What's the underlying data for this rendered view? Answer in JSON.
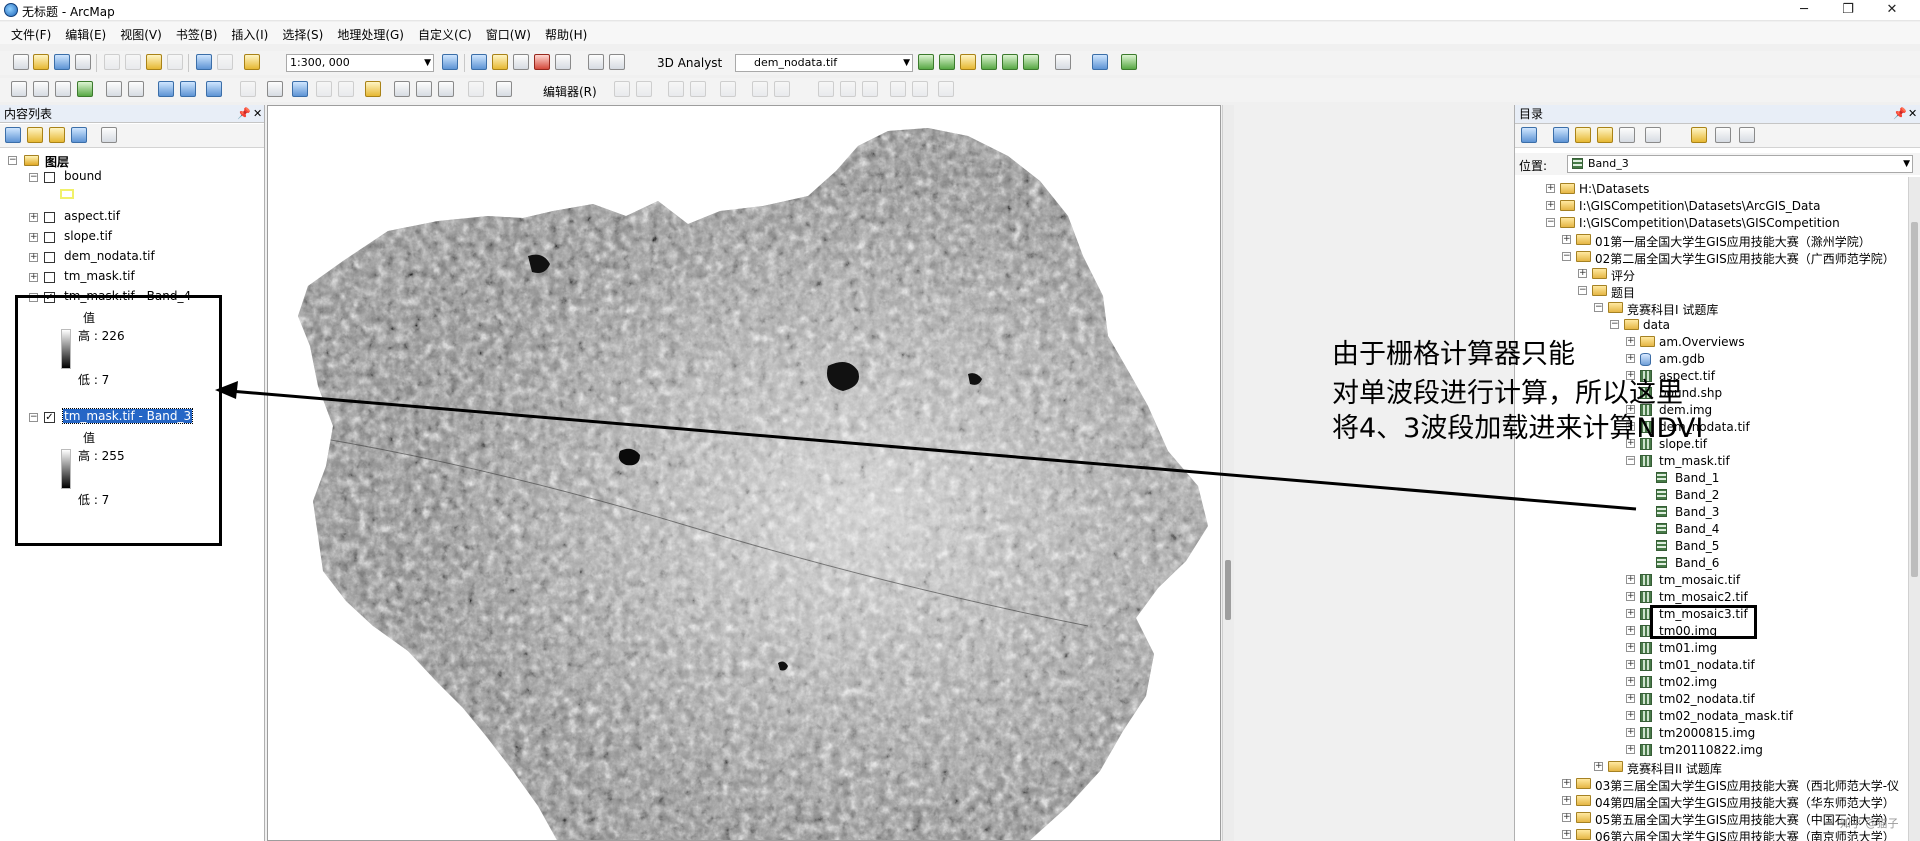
{
  "window": {
    "title": "无标题 - ArcMap",
    "minimize": "─",
    "maximize": "❐",
    "close": "✕"
  },
  "menu": [
    "文件(F)",
    "编辑(E)",
    "视图(V)",
    "书签(B)",
    "插入(I)",
    "选择(S)",
    "地理处理(G)",
    "自定义(C)",
    "窗口(W)",
    "帮助(H)"
  ],
  "toolbar": {
    "scale": "1:300, 000",
    "analyst": "3D Analyst",
    "layer_combo": "dem_nodata.tif",
    "editor": "编辑器(R)"
  },
  "toc": {
    "title": "内容列表",
    "root": "图层",
    "layers": [
      {
        "name": "bound",
        "checked": false,
        "expanded": true
      },
      {
        "name": "aspect.tif",
        "checked": false,
        "expanded": false
      },
      {
        "name": "slope.tif",
        "checked": false,
        "expanded": false
      },
      {
        "name": "dem_nodata.tif",
        "checked": false,
        "expanded": false
      },
      {
        "name": "tm_mask.tif",
        "checked": false,
        "expanded": false
      },
      {
        "name": "tm_mask.tif - Band_4",
        "checked": true,
        "expanded": true,
        "value_label": "值",
        "high": "高 : 226",
        "low": "低 : 7"
      },
      {
        "name": "tm_mask.tif - Band_3",
        "checked": true,
        "expanded": true,
        "selected": true,
        "value_label": "值",
        "high": "高 : 255",
        "low": "低 : 7"
      }
    ]
  },
  "catalog": {
    "title": "目录",
    "location_label": "位置:",
    "location_value": "Band_3",
    "tree": [
      {
        "label": "H:\\Datasets",
        "level": 0,
        "exp": "+",
        "icon": "folder"
      },
      {
        "label": "I:\\GISCompetition\\Datasets\\ArcGIS_Data",
        "level": 0,
        "exp": "+",
        "icon": "folder"
      },
      {
        "label": "I:\\GISCompetition\\Datasets\\GISCompetition",
        "level": 0,
        "exp": "−",
        "icon": "folder"
      },
      {
        "label": "01第一届全国大学生GIS应用技能大赛（滁州学院）",
        "level": 1,
        "exp": "+",
        "icon": "folder"
      },
      {
        "label": "02第二届全国大学生GIS应用技能大赛（广西师范学院）",
        "level": 1,
        "exp": "−",
        "icon": "folder"
      },
      {
        "label": "评分",
        "level": 2,
        "exp": "+",
        "icon": "folder"
      },
      {
        "label": "题目",
        "level": 2,
        "exp": "−",
        "icon": "folder"
      },
      {
        "label": "竞赛科目I  试题库",
        "level": 3,
        "exp": "−",
        "icon": "folder"
      },
      {
        "label": "data",
        "level": 4,
        "exp": "−",
        "icon": "folder"
      },
      {
        "label": "am.Overviews",
        "level": 5,
        "exp": "+",
        "icon": "folder"
      },
      {
        "label": "am.gdb",
        "level": 5,
        "exp": "+",
        "icon": "db"
      },
      {
        "label": "aspect.tif",
        "level": 5,
        "exp": "+",
        "icon": "raster"
      },
      {
        "label": "bound.shp",
        "level": 5,
        "exp": "",
        "icon": "raster"
      },
      {
        "label": "dem.img",
        "level": 5,
        "exp": "+",
        "icon": "raster"
      },
      {
        "label": "dem_nodata.tif",
        "level": 5,
        "exp": "+",
        "icon": "raster"
      },
      {
        "label": "slope.tif",
        "level": 5,
        "exp": "+",
        "icon": "raster"
      },
      {
        "label": "tm_mask.tif",
        "level": 5,
        "exp": "−",
        "icon": "raster"
      },
      {
        "label": "Band_1",
        "level": 6,
        "exp": "",
        "icon": "grid"
      },
      {
        "label": "Band_2",
        "level": 6,
        "exp": "",
        "icon": "grid"
      },
      {
        "label": "Band_3",
        "level": 6,
        "exp": "",
        "icon": "grid"
      },
      {
        "label": "Band_4",
        "level": 6,
        "exp": "",
        "icon": "grid"
      },
      {
        "label": "Band_5",
        "level": 6,
        "exp": "",
        "icon": "grid"
      },
      {
        "label": "Band_6",
        "level": 6,
        "exp": "",
        "icon": "grid"
      },
      {
        "label": "tm_mosaic.tif",
        "level": 5,
        "exp": "+",
        "icon": "raster"
      },
      {
        "label": "tm_mosaic2.tif",
        "level": 5,
        "exp": "+",
        "icon": "raster"
      },
      {
        "label": "tm_mosaic3.tif",
        "level": 5,
        "exp": "+",
        "icon": "raster"
      },
      {
        "label": "tm00.img",
        "level": 5,
        "exp": "+",
        "icon": "raster"
      },
      {
        "label": "tm01.img",
        "level": 5,
        "exp": "+",
        "icon": "raster"
      },
      {
        "label": "tm01_nodata.tif",
        "level": 5,
        "exp": "+",
        "icon": "raster"
      },
      {
        "label": "tm02.img",
        "level": 5,
        "exp": "+",
        "icon": "raster"
      },
      {
        "label": "tm02_nodata.tif",
        "level": 5,
        "exp": "+",
        "icon": "raster"
      },
      {
        "label": "tm02_nodata_mask.tif",
        "level": 5,
        "exp": "+",
        "icon": "raster"
      },
      {
        "label": "tm2000815.img",
        "level": 5,
        "exp": "+",
        "icon": "raster"
      },
      {
        "label": "tm20110822.img",
        "level": 5,
        "exp": "+",
        "icon": "raster"
      },
      {
        "label": "竞赛科目II  试题库",
        "level": 3,
        "exp": "+",
        "icon": "folder"
      },
      {
        "label": "03第三届全国大学生GIS应用技能大赛（西北师范大学-仪",
        "level": 1,
        "exp": "+",
        "icon": "folder"
      },
      {
        "label": "04第四届全国大学生GIS应用技能大赛（华东师范大学）",
        "level": 1,
        "exp": "+",
        "icon": "folder"
      },
      {
        "label": "05第五届全国大学生GIS应用技能大赛（中国石油大学）",
        "level": 1,
        "exp": "+",
        "icon": "folder"
      },
      {
        "label": "06第六届全国大学生GIS应用技能大赛（南京师范大学）",
        "level": 1,
        "exp": "+",
        "icon": "folder"
      }
    ]
  },
  "annotation": {
    "lines": [
      "由于栅格计算器只能",
      "对单波段进行计算，所以这里",
      "将4、3波段加载进来计算NDVI"
    ]
  },
  "watermark": "知乎 @猫子",
  "colors": {
    "selection": "#2566c6",
    "panel_header": "#e8eef7",
    "annotation": "#000000"
  }
}
